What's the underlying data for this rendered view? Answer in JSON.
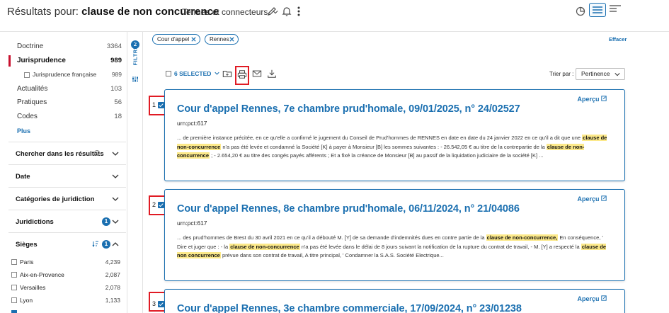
{
  "header": {
    "title_prefix": "Résultats pour:",
    "query": "clause de non concurrence",
    "terms_label": "Termes et connecteurs"
  },
  "sidebar": {
    "content_types": [
      {
        "label": "Doctrine",
        "count": "3364"
      },
      {
        "label": "Jurisprudence",
        "count": "989"
      },
      {
        "label": "Jurisprudence française",
        "count": "989"
      },
      {
        "label": "Actualités",
        "count": "103"
      },
      {
        "label": "Pratiques",
        "count": "56"
      },
      {
        "label": "Codes",
        "count": "18"
      }
    ],
    "plus_label": "Plus",
    "sections": [
      {
        "label": "Chercher dans les résultats"
      },
      {
        "label": "Date"
      },
      {
        "label": "Catégories de juridiction"
      },
      {
        "label": "Juridictions",
        "badge": "1"
      },
      {
        "label": "Sièges",
        "badge": "1"
      }
    ],
    "seats": [
      {
        "label": "Paris",
        "count": "4,239"
      },
      {
        "label": "Aix-en-Provence",
        "count": "2,087"
      },
      {
        "label": "Versailles",
        "count": "2,078"
      },
      {
        "label": "Lyon",
        "count": "1,133"
      }
    ]
  },
  "filters_tab": {
    "label": "FILTRES",
    "count": "2"
  },
  "chips": [
    {
      "label": "Cour d'appel"
    },
    {
      "label": "Rennes"
    }
  ],
  "effacer_label": "Effacer",
  "toolbar": {
    "selected_label": "6 SELECTED",
    "sort_label": "Trier par :",
    "sort_value": "Pertinence"
  },
  "results": [
    {
      "num": "1",
      "title": "Cour d'appel Rennes, 7e chambre prud'homale, 09/01/2025, n° 24/02527",
      "urn": "urn:pct:617",
      "apercu": "Aperçu",
      "snippet_parts": [
        "... de première instance précitée, en ce qu'elle a confirmé le jugement du Conseil de Prud'hommes de RENNES en date en date du 24 janvier 2022 en ce qu'il a dit que une ",
        "clause de non-concurrence",
        " n'a pas été levée et condamné la Société [K] à payer à Monsieur [B] les sommes suivantes : - 26.542,05 € au titre de la contrepartie de la ",
        "clause de non-concurrence",
        " ; - 2.654,20 € au titre des congés payés afférents ; Et a fixé la créance de Monsieur [B] au passif de la liquidation judiciaire de la société [K] ..."
      ]
    },
    {
      "num": "2",
      "title": "Cour d'appel Rennes, 8e chambre prud'homale, 06/11/2024, n° 21/04086",
      "urn": "urn:pct:617",
      "apercu": "Aperçu",
      "snippet_parts": [
        "... des prud'hommes de Brest du 30 avril 2021 en ce qu'il a débouté M. [Y] de sa demande d'indemnités dues en contre partie de la ",
        "clause de non-concurrence,",
        " En conséquence, ' Dire et juger que : - la ",
        "clause de non-concurrence",
        " n'a pas été levée dans le délai de 8 jours suivant la notification de la rupture du contrat de travail, - M. [Y] a respecté la ",
        "clause de non concurrence",
        " prévue dans son contrat de travail, A titre principal, ' Condamner la S.A.S. Société Electrique..."
      ]
    },
    {
      "num": "3",
      "title": "Cour d'appel Rennes, 3e chambre commerciale, 17/09/2024, n° 23/01238",
      "apercu": "Aperçu"
    }
  ],
  "colors": {
    "accent": "#1a6fb0",
    "highlight": "#fce98a",
    "annotation_red": "#e01b24",
    "active_red": "#c8102e"
  }
}
